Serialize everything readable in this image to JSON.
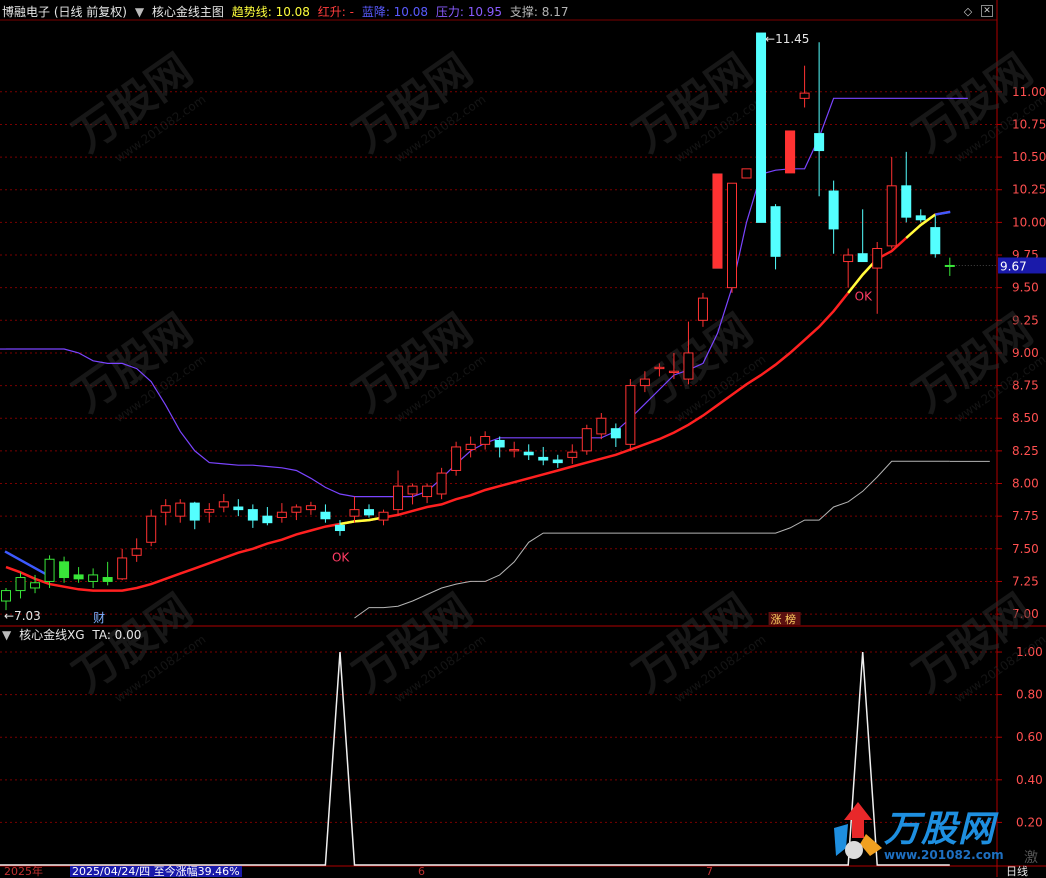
{
  "header": {
    "stock_label": "博融电子 (日线 前复权)",
    "indicator_name": "核心金线主图",
    "trend_label": "趋势线: 10.08",
    "hong_label": "红升: -",
    "lan_label": "蓝降: 10.08",
    "pressure_label": "压力: 10.95",
    "support_label": "支撑: 8.17"
  },
  "lower_header": {
    "indicator_name": "核心金线XG",
    "ta_label": "TA: 0.00"
  },
  "price_axis": {
    "ticks": [
      "11.00",
      "10.75",
      "10.50",
      "10.25",
      "10.00",
      "9.75",
      "9.50",
      "9.25",
      "9.00",
      "8.75",
      "8.50",
      "8.25",
      "8.00",
      "7.75",
      "7.50",
      "7.25",
      "7.00"
    ],
    "current_price_label": "9.67",
    "range": [
      6.97,
      11.55
    ]
  },
  "lower_axis": {
    "ticks": [
      "1.00",
      "0.80",
      "0.60",
      "0.40",
      "0.20"
    ],
    "range": [
      0,
      1.08
    ]
  },
  "annotations": {
    "high_label": "11.45",
    "low_label": "7.03",
    "ok_1": "OK",
    "ok_2": "OK",
    "cai_tag": "财",
    "zhangbang_tag": "涨 榜"
  },
  "footer": {
    "year_label": "2025年",
    "date_label": "2025/04/24/四  至今涨幅39.46%",
    "mark_6": "6",
    "mark_7": "7",
    "period_label": "日线",
    "watermark_brand": "万股网",
    "watermark_url": "www.201082.com",
    "watermark_corner": "激"
  },
  "colors": {
    "up": "#ff3232",
    "down": "#54ffff",
    "flat": "#aaaaaa",
    "green": "#39e639",
    "ma_red": "#ff2020",
    "pressure": "#7a44ff",
    "support": "#b4b4b4",
    "grid": "#7a0000",
    "axis_text": "#ff5050",
    "trend_label": "#ffff3c",
    "hong_label": "#ff3c3c",
    "lan_label": "#5a5aff",
    "pressure_label": "#8a5cff",
    "current_bg": "#1a1aaa"
  },
  "chart_data": [
    {
      "type": "candlestick",
      "title": "核心金线主图",
      "ylim": [
        6.97,
        11.55
      ],
      "candles": [
        {
          "o": 7.1,
          "h": 7.2,
          "l": 7.03,
          "c": 7.18,
          "color": "green"
        },
        {
          "o": 7.18,
          "h": 7.32,
          "l": 7.12,
          "c": 7.28,
          "color": "green"
        },
        {
          "o": 7.2,
          "h": 7.3,
          "l": 7.16,
          "c": 7.24,
          "color": "green"
        },
        {
          "o": 7.25,
          "h": 7.45,
          "l": 7.2,
          "c": 7.42,
          "color": "green"
        },
        {
          "o": 7.4,
          "h": 7.44,
          "l": 7.24,
          "c": 7.28,
          "color": "green"
        },
        {
          "o": 7.3,
          "h": 7.36,
          "l": 7.24,
          "c": 7.27,
          "color": "green"
        },
        {
          "o": 7.25,
          "h": 7.35,
          "l": 7.2,
          "c": 7.3,
          "color": "green"
        },
        {
          "o": 7.28,
          "h": 7.4,
          "l": 7.22,
          "c": 7.25,
          "color": "green"
        },
        {
          "o": 7.27,
          "h": 7.5,
          "l": 7.26,
          "c": 7.43,
          "color": "up"
        },
        {
          "o": 7.45,
          "h": 7.58,
          "l": 7.4,
          "c": 7.5,
          "color": "up"
        },
        {
          "o": 7.55,
          "h": 7.8,
          "l": 7.52,
          "c": 7.75,
          "color": "up"
        },
        {
          "o": 7.78,
          "h": 7.88,
          "l": 7.68,
          "c": 7.83,
          "color": "up"
        },
        {
          "o": 7.75,
          "h": 7.88,
          "l": 7.7,
          "c": 7.85,
          "color": "up"
        },
        {
          "o": 7.85,
          "h": 7.86,
          "l": 7.65,
          "c": 7.72,
          "color": "up"
        },
        {
          "o": 7.78,
          "h": 7.85,
          "l": 7.7,
          "c": 7.8,
          "color": "up"
        },
        {
          "o": 7.82,
          "h": 7.92,
          "l": 7.78,
          "c": 7.86,
          "color": "up"
        },
        {
          "o": 7.82,
          "h": 7.88,
          "l": 7.75,
          "c": 7.8,
          "color": "up"
        },
        {
          "o": 7.8,
          "h": 7.84,
          "l": 7.66,
          "c": 7.72,
          "color": "up"
        },
        {
          "o": 7.75,
          "h": 7.82,
          "l": 7.68,
          "c": 7.7,
          "color": "up"
        },
        {
          "o": 7.74,
          "h": 7.85,
          "l": 7.7,
          "c": 7.78,
          "color": "up"
        },
        {
          "o": 7.78,
          "h": 7.84,
          "l": 7.72,
          "c": 7.82,
          "color": "up"
        },
        {
          "o": 7.8,
          "h": 7.86,
          "l": 7.76,
          "c": 7.83,
          "color": "up"
        },
        {
          "o": 7.78,
          "h": 7.84,
          "l": 7.7,
          "c": 7.73,
          "color": "up"
        },
        {
          "o": 7.68,
          "h": 7.72,
          "l": 7.6,
          "c": 7.64,
          "color": "up"
        },
        {
          "o": 7.75,
          "h": 7.9,
          "l": 7.7,
          "c": 7.8,
          "color": "up"
        },
        {
          "o": 7.8,
          "h": 7.84,
          "l": 7.74,
          "c": 7.76,
          "color": "up"
        },
        {
          "o": 7.72,
          "h": 7.8,
          "l": 7.68,
          "c": 7.78,
          "color": "up"
        },
        {
          "o": 7.8,
          "h": 8.1,
          "l": 7.75,
          "c": 7.98,
          "color": "up"
        },
        {
          "o": 7.92,
          "h": 8.0,
          "l": 7.84,
          "c": 7.98,
          "color": "up"
        },
        {
          "o": 7.9,
          "h": 8.0,
          "l": 7.85,
          "c": 7.98,
          "color": "up"
        },
        {
          "o": 7.92,
          "h": 8.12,
          "l": 7.88,
          "c": 8.08,
          "color": "up"
        },
        {
          "o": 8.1,
          "h": 8.32,
          "l": 8.06,
          "c": 8.28,
          "color": "up"
        },
        {
          "o": 8.26,
          "h": 8.36,
          "l": 8.2,
          "c": 8.3,
          "color": "up"
        },
        {
          "o": 8.3,
          "h": 8.4,
          "l": 8.26,
          "c": 8.36,
          "color": "up"
        },
        {
          "o": 8.33,
          "h": 8.36,
          "l": 8.2,
          "c": 8.28,
          "color": "up"
        },
        {
          "o": 8.25,
          "h": 8.32,
          "l": 8.2,
          "c": 8.26,
          "color": "up"
        },
        {
          "o": 8.24,
          "h": 8.3,
          "l": 8.18,
          "c": 8.22,
          "color": "up"
        },
        {
          "o": 8.2,
          "h": 8.28,
          "l": 8.14,
          "c": 8.18,
          "color": "up"
        },
        {
          "o": 8.18,
          "h": 8.22,
          "l": 8.12,
          "c": 8.16,
          "color": "up"
        },
        {
          "o": 8.2,
          "h": 8.3,
          "l": 8.15,
          "c": 8.24,
          "color": "up"
        },
        {
          "o": 8.25,
          "h": 8.45,
          "l": 8.22,
          "c": 8.42,
          "color": "up"
        },
        {
          "o": 8.38,
          "h": 8.54,
          "l": 8.34,
          "c": 8.5,
          "color": "up"
        },
        {
          "o": 8.42,
          "h": 8.46,
          "l": 8.28,
          "c": 8.35,
          "color": "up"
        },
        {
          "o": 8.3,
          "h": 8.8,
          "l": 8.25,
          "c": 8.75,
          "color": "up"
        },
        {
          "o": 8.75,
          "h": 8.86,
          "l": 8.7,
          "c": 8.8,
          "color": "up"
        },
        {
          "o": 8.88,
          "h": 8.92,
          "l": 8.82,
          "c": 8.89,
          "color": "up"
        },
        {
          "o": 8.85,
          "h": 9.0,
          "l": 8.8,
          "c": 8.86,
          "color": "up"
        },
        {
          "o": 8.8,
          "h": 9.24,
          "l": 8.76,
          "c": 9.0,
          "color": "up"
        },
        {
          "o": 9.25,
          "h": 9.46,
          "l": 9.2,
          "c": 9.42,
          "color": "up"
        },
        {
          "o": 10.37,
          "h": 10.37,
          "l": 9.65,
          "c": 9.65,
          "color": "up"
        },
        {
          "o": 9.5,
          "h": 10.3,
          "l": 9.46,
          "c": 10.3,
          "color": "up"
        },
        {
          "o": 10.34,
          "h": 10.41,
          "l": 10.34,
          "c": 10.41,
          "color": "up"
        },
        {
          "o": 11.45,
          "h": 11.45,
          "l": 10.0,
          "c": 10.0,
          "color": "up"
        },
        {
          "o": 10.12,
          "h": 10.14,
          "l": 9.64,
          "c": 9.74,
          "color": "up"
        },
        {
          "o": 10.38,
          "h": 10.7,
          "l": 10.38,
          "c": 10.7,
          "color": "up"
        },
        {
          "o": 10.95,
          "h": 11.2,
          "l": 10.88,
          "c": 10.99,
          "color": "up"
        },
        {
          "o": 10.68,
          "h": 11.38,
          "l": 10.2,
          "c": 10.55,
          "color": "up"
        },
        {
          "o": 10.24,
          "h": 10.32,
          "l": 9.76,
          "c": 9.95,
          "color": "up"
        },
        {
          "o": 9.7,
          "h": 9.8,
          "l": 9.5,
          "c": 9.75,
          "color": "up"
        },
        {
          "o": 9.76,
          "h": 10.1,
          "l": 9.7,
          "c": 9.7,
          "color": "up"
        },
        {
          "o": 9.65,
          "h": 9.85,
          "l": 9.3,
          "c": 9.8,
          "color": "up"
        },
        {
          "o": 9.82,
          "h": 10.5,
          "l": 9.8,
          "c": 10.28,
          "color": "up"
        },
        {
          "o": 10.28,
          "h": 10.54,
          "l": 10.0,
          "c": 10.04,
          "color": "up"
        },
        {
          "o": 10.05,
          "h": 10.1,
          "l": 10.0,
          "c": 10.02,
          "color": "up"
        },
        {
          "o": 9.96,
          "h": 10.05,
          "l": 9.73,
          "c": 9.76,
          "color": "up"
        },
        {
          "o": 9.67,
          "h": 9.73,
          "l": 9.59,
          "c": 9.67,
          "color": "green"
        }
      ],
      "ma_trend": [
        7.36,
        7.32,
        7.27,
        7.23,
        7.21,
        7.19,
        7.18,
        7.18,
        7.18,
        7.2,
        7.23,
        7.27,
        7.31,
        7.35,
        7.39,
        7.43,
        7.47,
        7.5,
        7.54,
        7.57,
        7.61,
        7.64,
        7.67,
        7.69,
        7.71,
        7.72,
        7.74,
        7.76,
        7.79,
        7.82,
        7.84,
        7.88,
        7.91,
        7.95,
        7.98,
        8.01,
        8.04,
        8.07,
        8.1,
        8.13,
        8.16,
        8.19,
        8.22,
        8.26,
        8.3,
        8.34,
        8.39,
        8.45,
        8.52,
        8.6,
        8.68,
        8.76,
        8.83,
        8.91,
        9.0,
        9.1,
        9.2,
        9.32,
        9.46,
        9.6,
        9.72,
        9.78,
        9.88,
        9.98,
        10.06,
        10.08
      ],
      "pressure": [
        9.03,
        9.03,
        9.03,
        9.03,
        9.03,
        9.0,
        8.94,
        8.92,
        8.92,
        8.88,
        8.78,
        8.6,
        8.4,
        8.25,
        8.16,
        8.15,
        8.14,
        8.14,
        8.13,
        8.12,
        8.1,
        8.04,
        7.97,
        7.92,
        7.9,
        7.9,
        7.9,
        7.9,
        7.9,
        7.94,
        8.04,
        8.15,
        8.25,
        8.31,
        8.35,
        8.35,
        8.35,
        8.35,
        8.35,
        8.35,
        8.35,
        8.35,
        8.4,
        8.5,
        8.61,
        8.72,
        8.83,
        8.87,
        8.92,
        9.15,
        9.5,
        10.0,
        10.37,
        10.4,
        10.41,
        10.41,
        10.65,
        10.95,
        10.95,
        10.95,
        10.95,
        10.95,
        10.95,
        10.95,
        10.95,
        10.95
      ],
      "support": [
        null,
        null,
        null,
        null,
        null,
        null,
        null,
        null,
        null,
        null,
        null,
        null,
        null,
        null,
        null,
        null,
        null,
        null,
        null,
        null,
        null,
        null,
        null,
        null,
        6.97,
        7.05,
        7.05,
        7.06,
        7.1,
        7.15,
        7.2,
        7.23,
        7.25,
        7.25,
        7.3,
        7.4,
        7.55,
        7.62,
        7.62,
        7.62,
        7.62,
        7.62,
        7.62,
        7.62,
        7.62,
        7.62,
        7.62,
        7.62,
        7.62,
        7.62,
        7.62,
        7.62,
        7.62,
        7.62,
        7.66,
        7.72,
        7.72,
        7.82,
        7.86,
        7.94,
        8.05,
        8.17,
        8.17,
        8.17,
        8.17,
        8.17
      ],
      "ok_signals": [
        23,
        59
      ]
    },
    {
      "type": "line",
      "title": "核心金线XG",
      "ylim": [
        0,
        1.08
      ],
      "series": [
        {
          "name": "TA",
          "values": [
            0,
            0,
            0,
            0,
            0,
            0,
            0,
            0,
            0,
            0,
            0,
            0,
            0,
            0,
            0,
            0,
            0,
            0,
            0,
            0,
            0,
            0,
            0,
            1,
            0,
            0,
            0,
            0,
            0,
            0,
            0,
            0,
            0,
            0,
            0,
            0,
            0,
            0,
            0,
            0,
            0,
            0,
            0,
            0,
            0,
            0,
            0,
            0,
            0,
            0,
            0,
            0,
            0,
            0,
            0,
            0,
            0,
            0,
            0,
            1,
            0,
            0,
            0,
            0,
            0,
            0
          ]
        }
      ]
    }
  ]
}
